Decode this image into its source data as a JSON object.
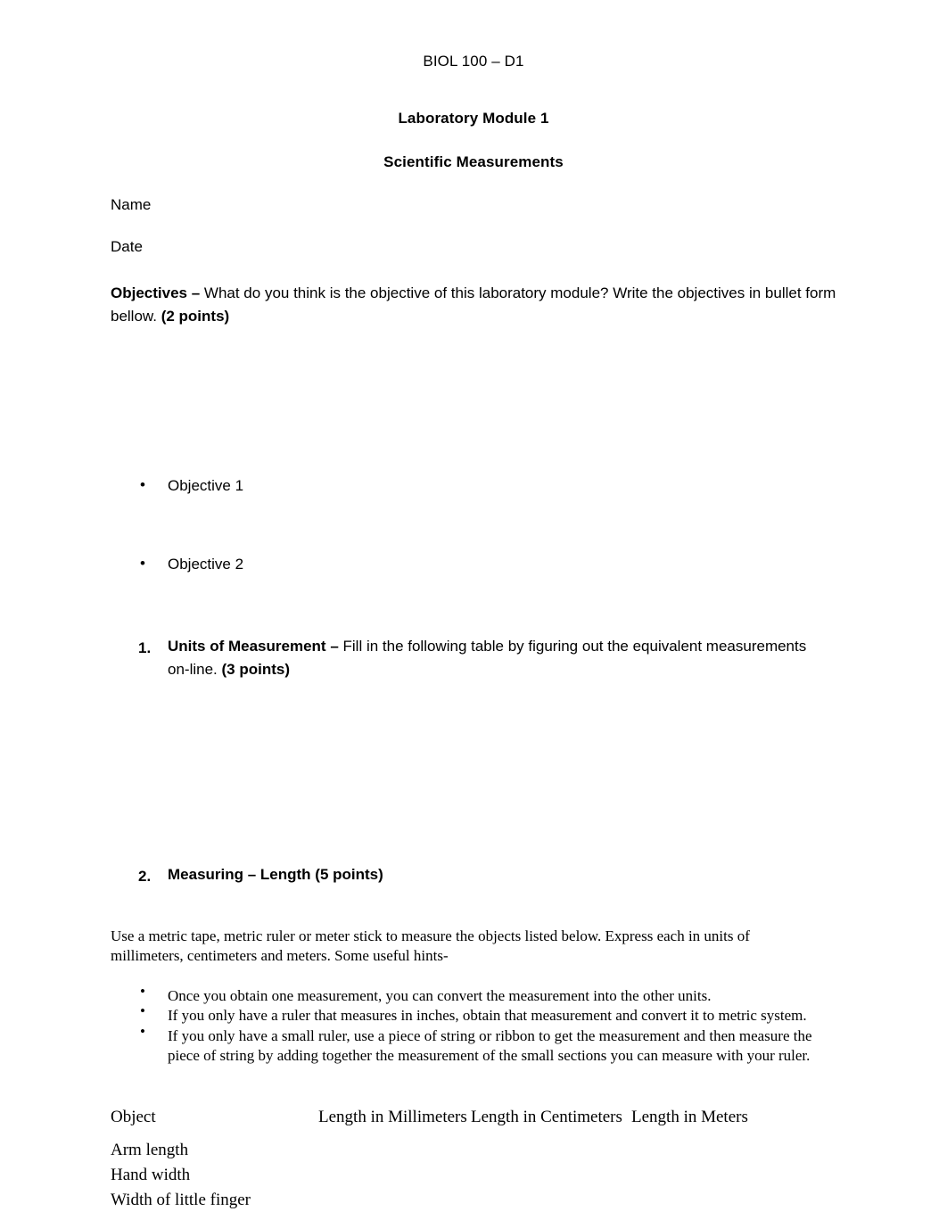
{
  "document": {
    "course_header": "BIOL 100 – D1",
    "title": "Laboratory Module 1",
    "subtitle": "Scientific Measurements",
    "name_label": "Name",
    "date_label": "Date"
  },
  "objectives": {
    "heading": "Objectives",
    "dash": " – ",
    "prompt": "What do you think is the objective of this laboratory module?  Write the objectives in bullet form bellow. ",
    "points": "(2 points)",
    "bullet_glyph": "•",
    "items": [
      {
        "label": "Objective 1"
      },
      {
        "label": "Objective 2"
      }
    ]
  },
  "questions": [
    {
      "number": "1.",
      "heading": "Units of Measurement",
      "dash": " – ",
      "body": "Fill in the following table by figuring out the equivalent measurements on-line. ",
      "points": "(3 points)"
    },
    {
      "number": "2.",
      "heading": "Measuring – Length (5 points)"
    }
  ],
  "length_section": {
    "intro": "Use a metric tape, metric ruler or meter stick to measure the objects listed below. Express each in units of millimeters, centimeters and meters. Some useful hints-",
    "bullet_glyph": "•",
    "hints": [
      "Once you obtain one measurement, you can convert the measurement into the other units.",
      "If you only have a ruler that measures in inches, obtain that measurement and convert it to metric system.",
      "If you only have a small ruler, use a piece of string or ribbon to get the measurement and then measure the piece of string by adding together the measurement of the small sections you can measure with your ruler."
    ],
    "table": {
      "headers": [
        "Object",
        "Length in Millimeters",
        "Length in Centimeters",
        "Length in Meters"
      ],
      "rows": [
        {
          "object": "Arm length",
          "mm": "",
          "cm": "",
          "m": ""
        },
        {
          "object": "Hand width",
          "mm": "",
          "cm": "",
          "m": ""
        },
        {
          "object": "Width of little finger",
          "mm": "",
          "cm": "",
          "m": ""
        }
      ]
    }
  }
}
